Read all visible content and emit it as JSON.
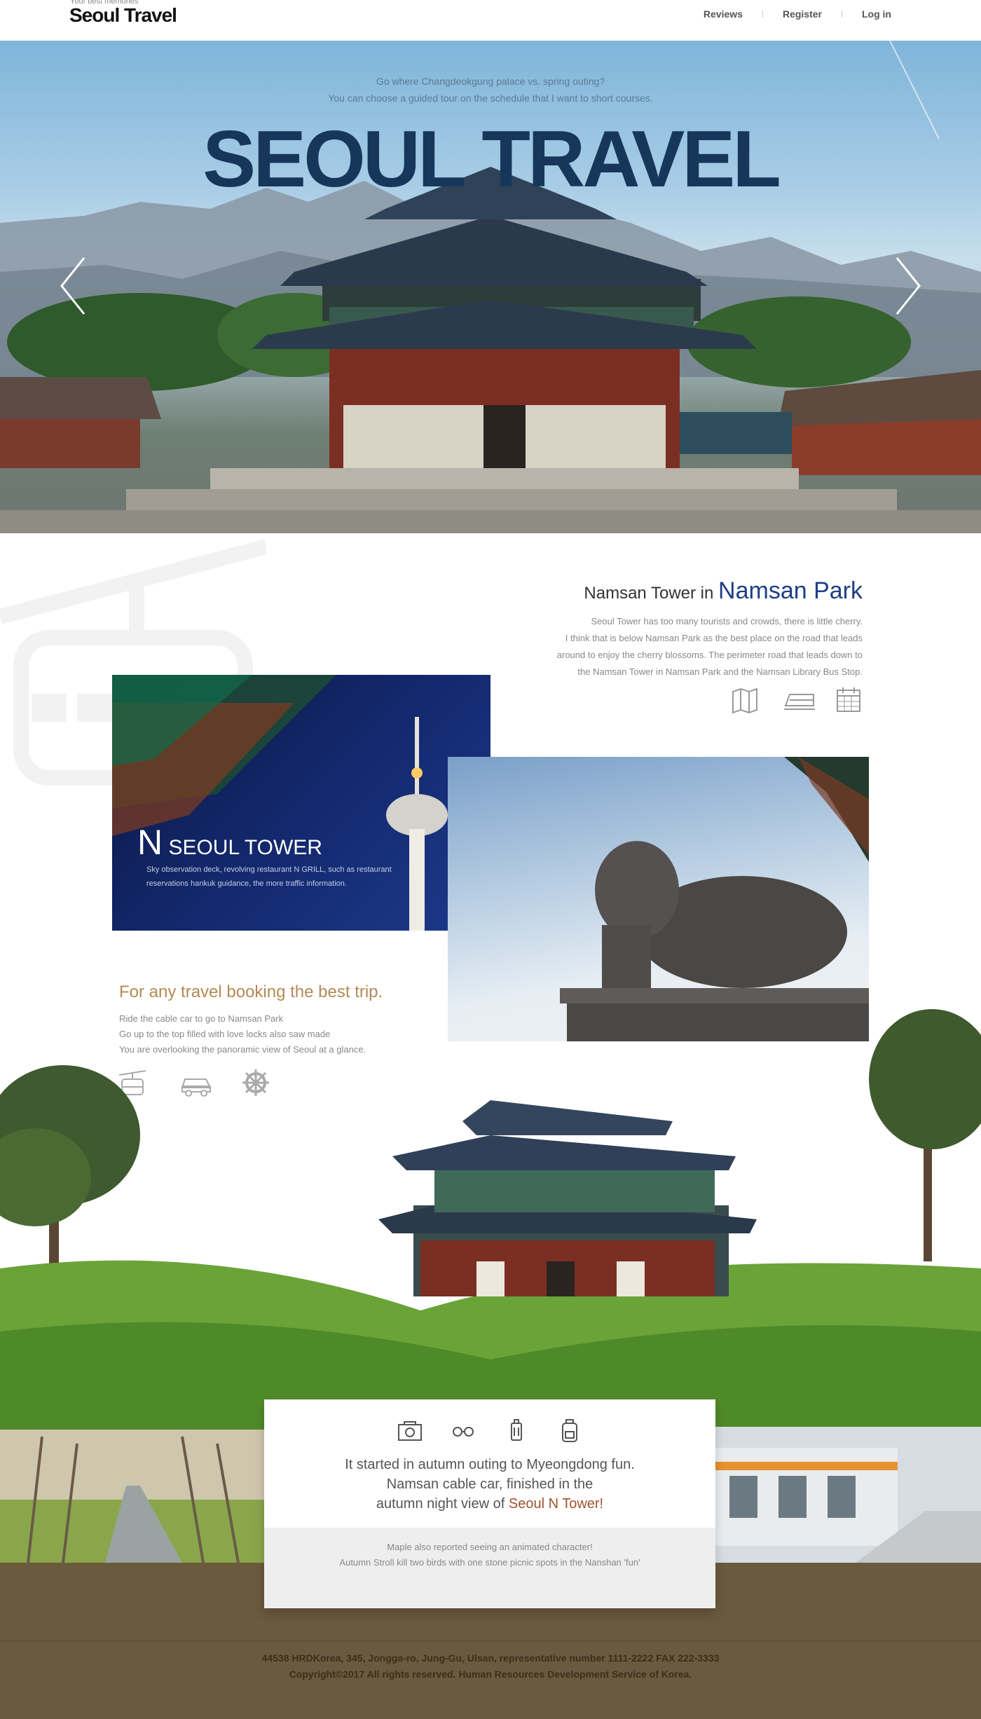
{
  "header": {
    "tagline": "Your best memories",
    "logo": "Seoul Travel",
    "nav": [
      "Reviews",
      "Register",
      "Log in"
    ]
  },
  "hero": {
    "subtitle_1": "Go where Changdeokgung palace vs. spring outing?",
    "subtitle_2": "You can choose a guided tour on the schedule that I want to short courses.",
    "title": "SEOUL TRAVEL"
  },
  "namsan": {
    "heading_small": "Namsan Tower in ",
    "heading_big": "Namsan Park",
    "desc": [
      "Seoul Tower has too many tourists and crowds, there is little cherry.",
      "I think that is below Namsan Park as the best place on the road that leads",
      "around to enjoy the cherry blossoms. The perimeter road that leads down to",
      "the Namsan Tower in Namsan Park and the Namsan Library Bus Stop."
    ],
    "icons": [
      "map-icon",
      "train-icon",
      "calendar-icon"
    ]
  },
  "tower_card": {
    "title_n": "N",
    "title_rest": " SEOUL TOWER",
    "desc": "Sky observation deck, revolving restaurant N GRILL, such as restaurant reservations hankuk guidance, the more traffic information."
  },
  "booking": {
    "title": "For any travel booking the best trip.",
    "lines": [
      "Ride the cable car to go to Namsan Park",
      "Go up to the top filled with love locks also saw made",
      "You are overlooking the panoramic view of Seoul at a glance."
    ],
    "icons": [
      "cable-car-icon",
      "car-icon",
      "ship-wheel-icon"
    ]
  },
  "card": {
    "icons": [
      "camera-icon",
      "glasses-icon",
      "luggage-icon",
      "backpack-icon"
    ],
    "line_1": "It started in autumn outing to Myeongdong fun.",
    "line_2": "Namsan cable car, finished in the",
    "line_3_prefix": "autumn night view of ",
    "line_3_highlight": "Seoul N Tower!",
    "sub_1": "Maple also reported seeing an animated character!",
    "sub_2": "Autumn Stroll kill two birds with one stone picnic spots in the Nanshan 'fun'"
  },
  "footer": {
    "address": "44538 HRDKorea, 345, Jongga-ro, Jung-Gu, Ulsan, representative number 1111-2222 FAX 222-3333",
    "copyright": "Copyright©2017 All rights reserved. Human Resources Development Service of Korea."
  },
  "colors": {
    "hero_title": "#17375a",
    "namsan_heading": "#1d3f85",
    "booking_title": "#b48a55",
    "highlight": "#a0522d",
    "footer_bg": "#6a5a3e"
  }
}
